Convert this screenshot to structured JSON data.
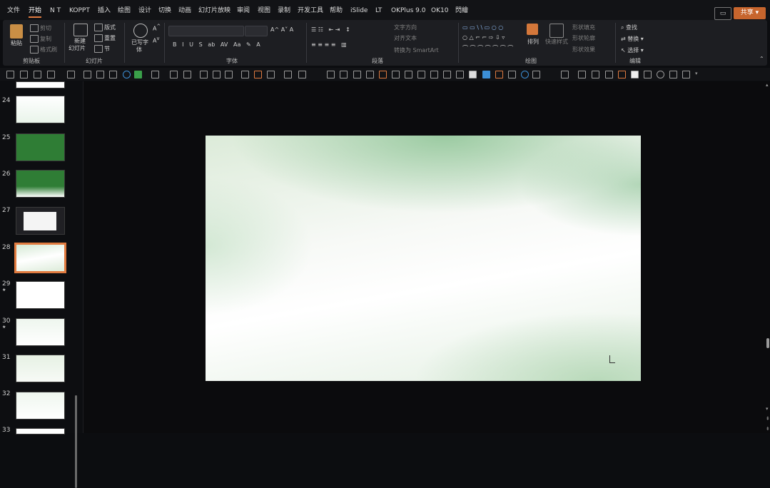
{
  "menu": {
    "items": [
      "文件",
      "开始",
      "N T",
      "KOPPT",
      "插入",
      "绘图",
      "设计",
      "切换",
      "动画",
      "幻灯片放映",
      "审阅",
      "视图",
      "录制",
      "开发工具",
      "帮助",
      "iSlide",
      "LT",
      "OKPlus 9.0",
      "OK10",
      "閃繪"
    ],
    "active": "开始",
    "comment_icon": "comment-icon",
    "share_label": "共享"
  },
  "ribbon": {
    "groups": [
      "剪贴板",
      "幻灯片",
      "",
      "字体",
      "段落",
      "绘图",
      "编辑"
    ],
    "clipboard": {
      "paste": "粘贴",
      "cut": "剪切",
      "copy": "复制",
      "format_painter": "格式刷"
    },
    "slides": {
      "new_slide": "新建",
      "new_slide_2": "幻灯片",
      "layout": "版式",
      "reset": "重置",
      "section": "节"
    },
    "font_extra": {
      "label": "已写字",
      "sub": "体"
    },
    "paragraph": {
      "text_direction": "文字方向",
      "align_text": "对齐文本",
      "smartart": "转换为 SmartArt"
    },
    "drawing": {
      "arrange": "排列",
      "quick_styles": "快速样式",
      "shape_fill": "形状填充",
      "shape_outline": "形状轮廓",
      "shape_effects": "形状效果"
    },
    "editing": {
      "find": "查找",
      "replace": "替换",
      "select": "选择"
    }
  },
  "slides_panel": {
    "numbers": [
      "24",
      "25",
      "26",
      "27",
      "28",
      "29",
      "30",
      "31",
      "32",
      "33"
    ],
    "selected": "28",
    "markers": {
      "29": "★",
      "30": "★"
    }
  },
  "colors": {
    "accent": "#e07a3f",
    "share": "#c7652d",
    "slide_green": "#8ec496"
  }
}
